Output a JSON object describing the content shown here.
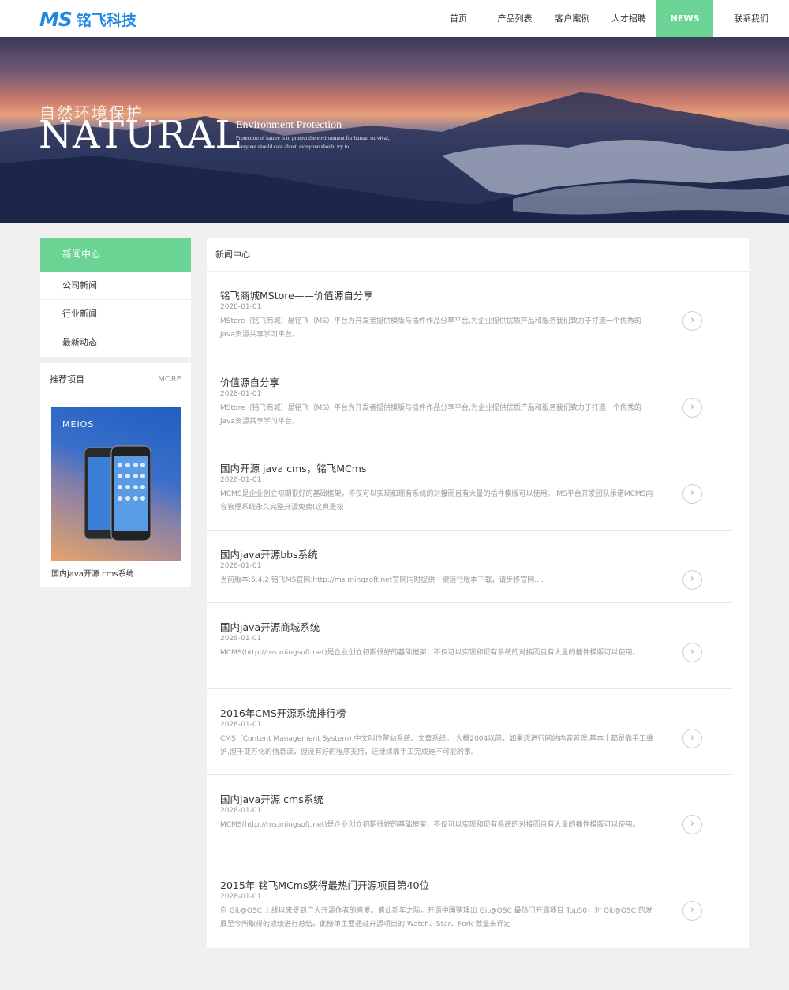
{
  "header": {
    "logo_mark": "MS",
    "logo_text": "铭飞科技",
    "nav": [
      "首页",
      "产品列表",
      "客户案例",
      "人才招聘",
      "NEWS",
      "联系我们"
    ],
    "active_nav": "NEWS"
  },
  "banner": {
    "cn_title": "自然环境保护",
    "big_title": "NATURAL",
    "sub_title": "Environment Protection",
    "small_line1": "Protection of nature is to protect the environment for human survival,",
    "small_line2": "everyone should care about, everyone should try to"
  },
  "sidebar": {
    "heading": "新闻中心",
    "items": [
      "公司新闻",
      "行业新闻",
      "最新动态"
    ],
    "recommend": {
      "heading": "推荐项目",
      "more": "MORE",
      "caption": "国内java开源 cms系统",
      "image_text": "MEIOS"
    }
  },
  "main": {
    "heading": "新闻中心",
    "news": [
      {
        "title": "铭飞商城MStore——价值源自分享",
        "date": "2028-01-01",
        "desc": "MStore（铭飞商城）是铭飞（MS）平台为开发者提供模版与插件作品分享平台,为企业提供优质产品和服务我们致力于打造一个优秀的Java资源共享学习平台。"
      },
      {
        "title": "价值源自分享",
        "date": "2028-01-01",
        "desc": "MStore（铭飞商城）是铭飞（MS）平台为开发者提供模版与插件作品分享平台,为企业提供优质产品和服务我们致力于打造一个优秀的Java资源共享学习平台。"
      },
      {
        "title": "国内开源 java cms，铭飞MCms",
        "date": "2028-01-01",
        "desc": "MCMS是企业创立初期很好的基础框架，不仅可以实现和现有系统的对接而且有大量的插件模版可以使用。 MS平台开发团队承诺MCMS内容管理系统永久完整开源免费(这真是极"
      },
      {
        "title": "国内java开源bbs系统",
        "date": "2028-01-01",
        "desc": "当前版本:5.4.2 铭飞MS官网:http://ms.mingsoft.net官网同时提供一键运行版本下载，请步移官网...."
      },
      {
        "title": "国内java开源商城系统",
        "date": "2028-01-01",
        "desc": "MCMS(http://ms.mingsoft.net)是企业创立初期很好的基础框架，不仅可以实现和现有系统的对接而且有大量的插件模版可以使用。"
      },
      {
        "title": "2016年CMS开源系统排行榜",
        "date": "2028-01-01",
        "desc": "CMS（Content Management System),中文叫作整站系统、文章系统。 大概2004以前，如果想进行网站内容管理,基本上都是靠手工维护,但千变万化的信息流，但没有好的程序支持，还继续靠手工完成是不可能的事。"
      },
      {
        "title": "国内java开源 cms系统",
        "date": "2028-01-01",
        "desc": "MCMS(http://ms.mingsoft.net)是企业创立初期很好的基础框架，不仅可以实现和现有系统的对接而且有大量的插件模版可以使用。"
      },
      {
        "title": "2015年 铭飞MCms获得最热门开源项目第40位",
        "date": "2028-01-01",
        "desc": "自 Git@OSC 上线以来受到广大开源作者的喜爱。值此新年之际，开源中国整理出 Git@OSC 最热门开源项目 Top50，对 Git@OSC 的发展至今所取得的成绩进行总结。此榜单主要通过开源项目的 Watch、Star、Fork 数量来评定"
      }
    ],
    "arrow_glyph": "›"
  },
  "colors": {
    "accent": "#6bd495",
    "brand": "#1e88e5"
  }
}
